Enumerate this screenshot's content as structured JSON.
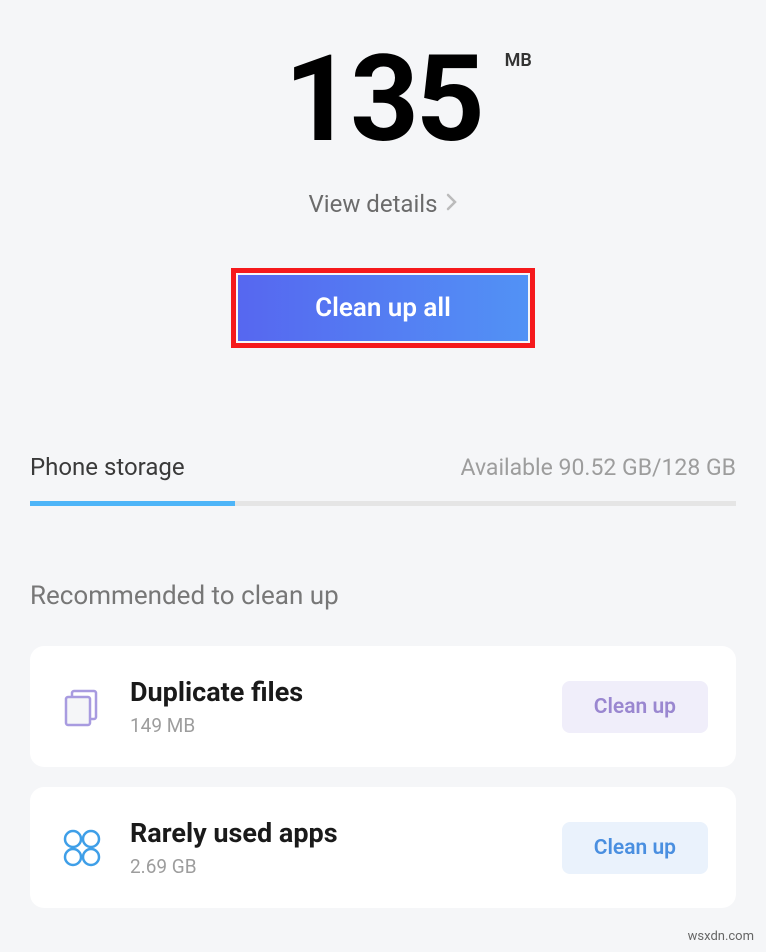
{
  "cleanable": {
    "amount": "135",
    "unit": "MB"
  },
  "view_details_label": "View details",
  "clean_all_label": "Clean up all",
  "storage": {
    "title": "Phone storage",
    "available_text": "Available 90.52 GB/128 GB",
    "used_percent": 29
  },
  "recommend_title": "Recommended to clean up",
  "cards": [
    {
      "title": "Duplicate files",
      "subtitle": "149 MB",
      "action": "Clean up"
    },
    {
      "title": "Rarely used apps",
      "subtitle": "2.69 GB",
      "action": "Clean up"
    }
  ],
  "watermark": "wsxdn.com"
}
